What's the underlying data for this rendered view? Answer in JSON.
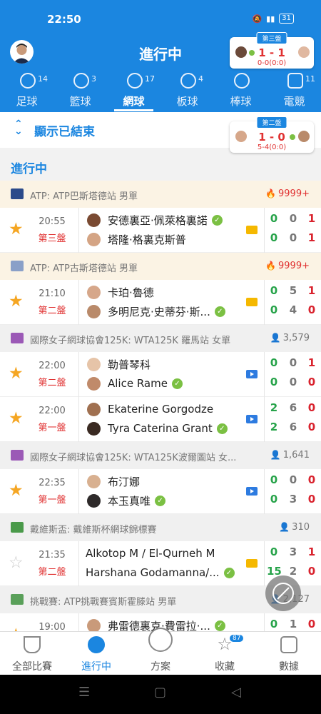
{
  "status_bar": {
    "time": "22:50",
    "battery": "31"
  },
  "header": {
    "title": "進行中",
    "mini_score_top": {
      "set": "第三盤",
      "score": "1 - 1",
      "sub": "0-0(0:0)"
    },
    "mini_score_second": {
      "set": "第二盤",
      "score": "1 - 0",
      "sub": "5-4(0:0)"
    }
  },
  "sport_tabs": [
    {
      "label": "足球",
      "count": "14",
      "icon": "soccer-ball-icon"
    },
    {
      "label": "籃球",
      "count": "3",
      "icon": "basketball-icon"
    },
    {
      "label": "網球",
      "count": "17",
      "icon": "tennis-ball-icon",
      "active": true
    },
    {
      "label": "板球",
      "count": "4",
      "icon": "cricket-icon"
    },
    {
      "label": "棒球",
      "count": "",
      "icon": "baseball-icon"
    },
    {
      "label": "電競",
      "count": "11",
      "icon": "gamepad-icon"
    }
  ],
  "show_ended": {
    "label": "顯示已結束"
  },
  "section": {
    "title": "進行中"
  },
  "leagues": [
    {
      "name": "ATP: ATP巴斯塔德站 男單",
      "count": "9999+",
      "count_icon": "fire-icon",
      "hot": true
    },
    {
      "name": "ATP: ATP古斯塔德站 男單",
      "count": "9999+",
      "count_icon": "fire-icon",
      "hot": true
    },
    {
      "name": "國際女子網球協會125K: WTA125K 羅馬站 女單",
      "count": "3,579",
      "count_icon": "user-icon"
    },
    {
      "name": "國際女子網球協會125K: WTA125K波爾圖站 女...",
      "count": "1,641",
      "count_icon": "user-icon"
    },
    {
      "name": "戴維斯盃: 戴維斯杯網球錦標賽",
      "count": "310",
      "count_icon": "user-icon"
    },
    {
      "name": "挑戰賽: ATP挑戰賽賓斯霍滕站 男單",
      "count": "2,127",
      "count_icon": "user-icon"
    }
  ],
  "matches": [
    {
      "time": "20:55",
      "set": "第三盤",
      "p1": "安德裏亞·佩萊格裏諾",
      "p2": "塔隆·格裏克斯普",
      "s1": [
        "0",
        "0",
        "1"
      ],
      "s2": [
        "0",
        "0",
        "1"
      ]
    },
    {
      "time": "21:10",
      "set": "第二盤",
      "p1": "卡珀·魯德",
      "p2": "多明尼克·史蒂芬·斯...",
      "s1": [
        "0",
        "5",
        "1"
      ],
      "s2": [
        "0",
        "4",
        "0"
      ]
    },
    {
      "time": "22:00",
      "set": "第二盤",
      "p1": "勒普琴科",
      "p2": "Alice Rame",
      "s1": [
        "0",
        "0",
        "1"
      ],
      "s2": [
        "0",
        "0",
        "0"
      ]
    },
    {
      "time": "22:00",
      "set": "第一盤",
      "p1": "Ekaterine Gorgodze",
      "p2": "Tyra Caterina Grant",
      "s1": [
        "2",
        "6",
        "0"
      ],
      "s2": [
        "2",
        "6",
        "0"
      ]
    },
    {
      "time": "22:35",
      "set": "第一盤",
      "p1": "布汀娜",
      "p2": "本玉真唯",
      "s1": [
        "0",
        "0",
        "0"
      ],
      "s2": [
        "0",
        "3",
        "0"
      ]
    },
    {
      "time": "21:35",
      "set": "第二盤",
      "p1": "Alkotop M / El-Qurneh M",
      "p2": "Harshana Godamanna/...",
      "s1": [
        "0",
        "3",
        "1"
      ],
      "s2": [
        "15",
        "2",
        "0"
      ]
    },
    {
      "time": "19:00",
      "set": "",
      "p1": "弗雷德裏克·費雷拉·...",
      "p2": "",
      "s1": [
        "0",
        "1",
        "0"
      ],
      "s2": [
        "",
        "",
        ""
      ]
    }
  ],
  "bottom_nav": [
    {
      "label": "全部比賽",
      "icon": "trophy-icon"
    },
    {
      "label": "進行中",
      "icon": "play-icon",
      "active": true
    },
    {
      "label": "方案",
      "icon": "document-icon"
    },
    {
      "label": "收藏",
      "icon": "star-icon",
      "badge": "87"
    },
    {
      "label": "數據",
      "icon": "chart-icon"
    }
  ],
  "colors": {
    "primary": "#1b86e0",
    "red": "#e03131",
    "green": "#27a34a",
    "star": "#f5a623"
  }
}
